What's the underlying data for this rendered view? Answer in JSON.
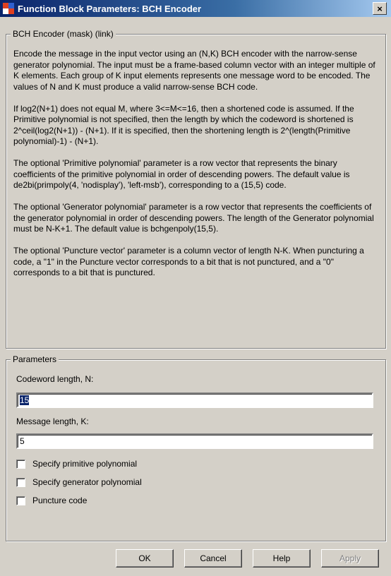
{
  "window": {
    "title": "Function Block Parameters: BCH Encoder",
    "close_label": "×"
  },
  "description": {
    "legend": "BCH Encoder (mask) (link)",
    "paragraphs": [
      "Encode the message in the input vector using an (N,K) BCH encoder with the narrow-sense generator polynomial. The input must be a frame-based column vector with an integer multiple of K elements. Each group of K input elements represents one message word to be encoded. The values of N and K must produce a valid narrow-sense BCH code.",
      "If log2(N+1) does not equal M, where 3<=M<=16, then a shortened code is assumed. If the Primitive polynomial is not specified, then the length by which the codeword is shortened is 2^ceil(log2(N+1)) - (N+1). If it is specified, then the shortening length is 2^(length(Primitive polynomial)-1) - (N+1).",
      "The optional 'Primitive polynomial' parameter is a row vector that represents the binary coefficients of the primitive polynomial in order of descending powers. The default value is de2bi(primpoly(4, 'nodisplay'), 'left-msb'), corresponding to a (15,5) code.",
      "The optional 'Generator polynomial' parameter is a row vector that represents the coefficients of the generator polynomial in order of descending powers. The length of the Generator polynomial must be N-K+1. The default value is bchgenpoly(15,5).",
      "The optional 'Puncture vector' parameter is a column vector of length N-K. When puncturing a code, a \"1\" in the Puncture vector corresponds to a bit that is not punctured, and a \"0\" corresponds to a bit that is punctured."
    ]
  },
  "parameters": {
    "legend": "Parameters",
    "codeword_label": "Codeword length, N:",
    "codeword_value": "15",
    "message_label": "Message length, K:",
    "message_value": "5",
    "checkboxes": [
      {
        "label": "Specify primitive polynomial",
        "checked": false
      },
      {
        "label": "Specify generator polynomial",
        "checked": false
      },
      {
        "label": "Puncture code",
        "checked": false
      }
    ]
  },
  "buttons": {
    "ok": "OK",
    "cancel": "Cancel",
    "help": "Help",
    "apply": "Apply"
  }
}
